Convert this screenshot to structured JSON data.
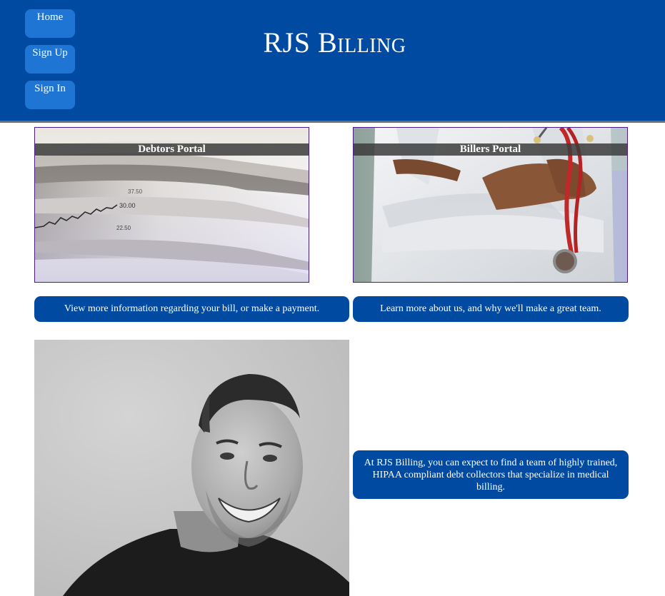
{
  "nav": {
    "home": "Home",
    "sign_up": "Sign Up",
    "sign_in": "Sign In"
  },
  "header": {
    "title_first": "RJS ",
    "title_second": "Billing"
  },
  "portals": {
    "debtors": {
      "label": "Debtors Portal",
      "description": "View more information regarding your bill, or make a payment.",
      "chart_ticks": [
        "30.00",
        "22.50",
        "37.50"
      ]
    },
    "billers": {
      "label": "Billers Portal",
      "description": "Learn more about us, and why we'll make a great team."
    }
  },
  "about": {
    "text": "At RJS Billing, you can expect to find a team of highly trained, HIPAA compliant debt collectors that specialize in medical billing."
  },
  "colors": {
    "header_bg": "#014aa1",
    "nav_button_bg": "#1f75d4",
    "panel_bg": "#014aa1",
    "portal_border": "#4b1a8a"
  }
}
